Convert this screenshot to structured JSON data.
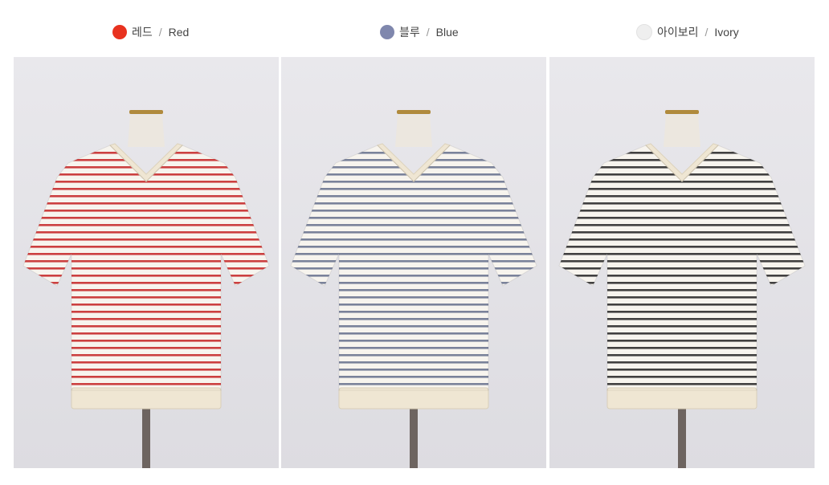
{
  "colors": [
    {
      "name_ko": "레드",
      "separator": "/",
      "name_en": "Red",
      "dot_color": "#e8321f",
      "stripe_color": "#c62c2c"
    },
    {
      "name_ko": "블루",
      "separator": "/",
      "name_en": "Blue",
      "dot_color": "#7f87ad",
      "stripe_color": "#6c7590"
    },
    {
      "name_ko": "아이보리",
      "separator": "/",
      "name_en": "Ivory",
      "dot_color": "#efefef",
      "stripe_color": "#2c2c2c"
    }
  ],
  "style": {
    "background_color": "#e4e3e8",
    "shirt_base_color": "#f7f4ee",
    "rib_color": "#efe6d3",
    "mannequin_color": "#ece7df",
    "stand_color": "#6d6460"
  }
}
